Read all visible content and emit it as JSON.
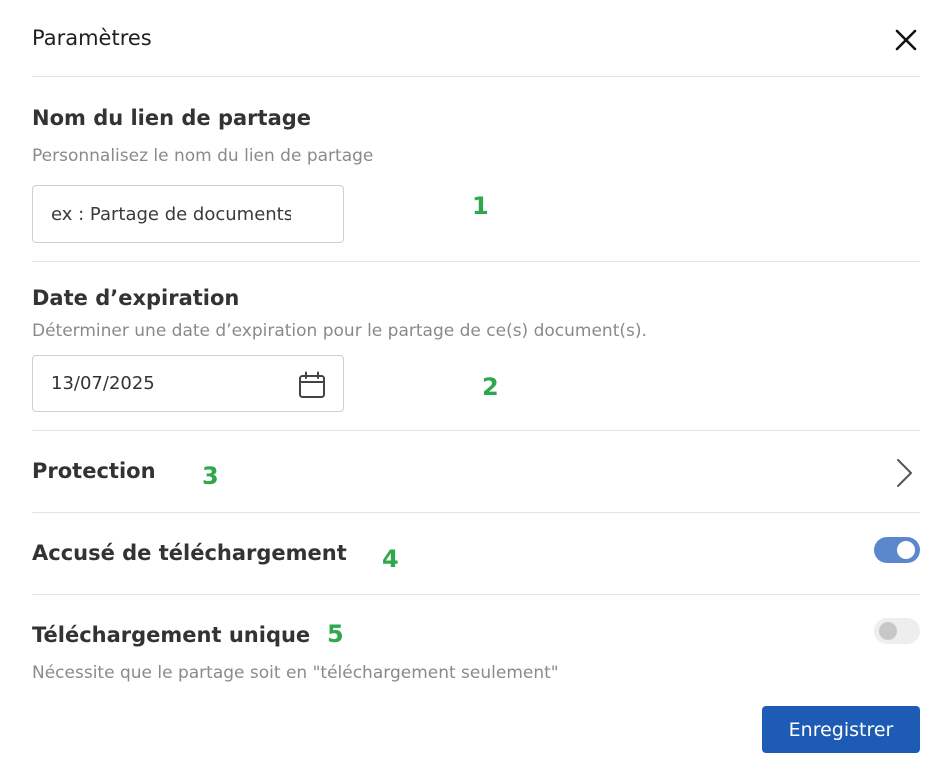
{
  "dialog": {
    "title": "Paramètres"
  },
  "share_name": {
    "title": "Nom du lien de partage",
    "description": "Personnalisez le nom du lien de partage",
    "placeholder": "ex : Partage de documents",
    "marker": "1"
  },
  "expiration": {
    "title": "Date d’expiration",
    "description": "Déterminer une date d’expiration pour le partage de ce(s) document(s).",
    "value": "13/07/2025",
    "marker": "2"
  },
  "protection": {
    "title": "Protection",
    "marker": "3"
  },
  "download_receipt": {
    "title": "Accusé de téléchargement",
    "enabled": true,
    "marker": "4"
  },
  "single_download": {
    "title": "Téléchargement unique",
    "description": "Nécessite que le partage soit en \"téléchargement seulement\"",
    "enabled": false,
    "marker": "5"
  },
  "footer": {
    "save_label": "Enregistrer"
  },
  "colors": {
    "primary": "#1e5bb5",
    "toggle_on": "#5b87cc",
    "marker": "#2ea84a"
  },
  "icons": {
    "close": "close-icon",
    "calendar": "calendar-icon",
    "chevron": "chevron-right-icon"
  }
}
